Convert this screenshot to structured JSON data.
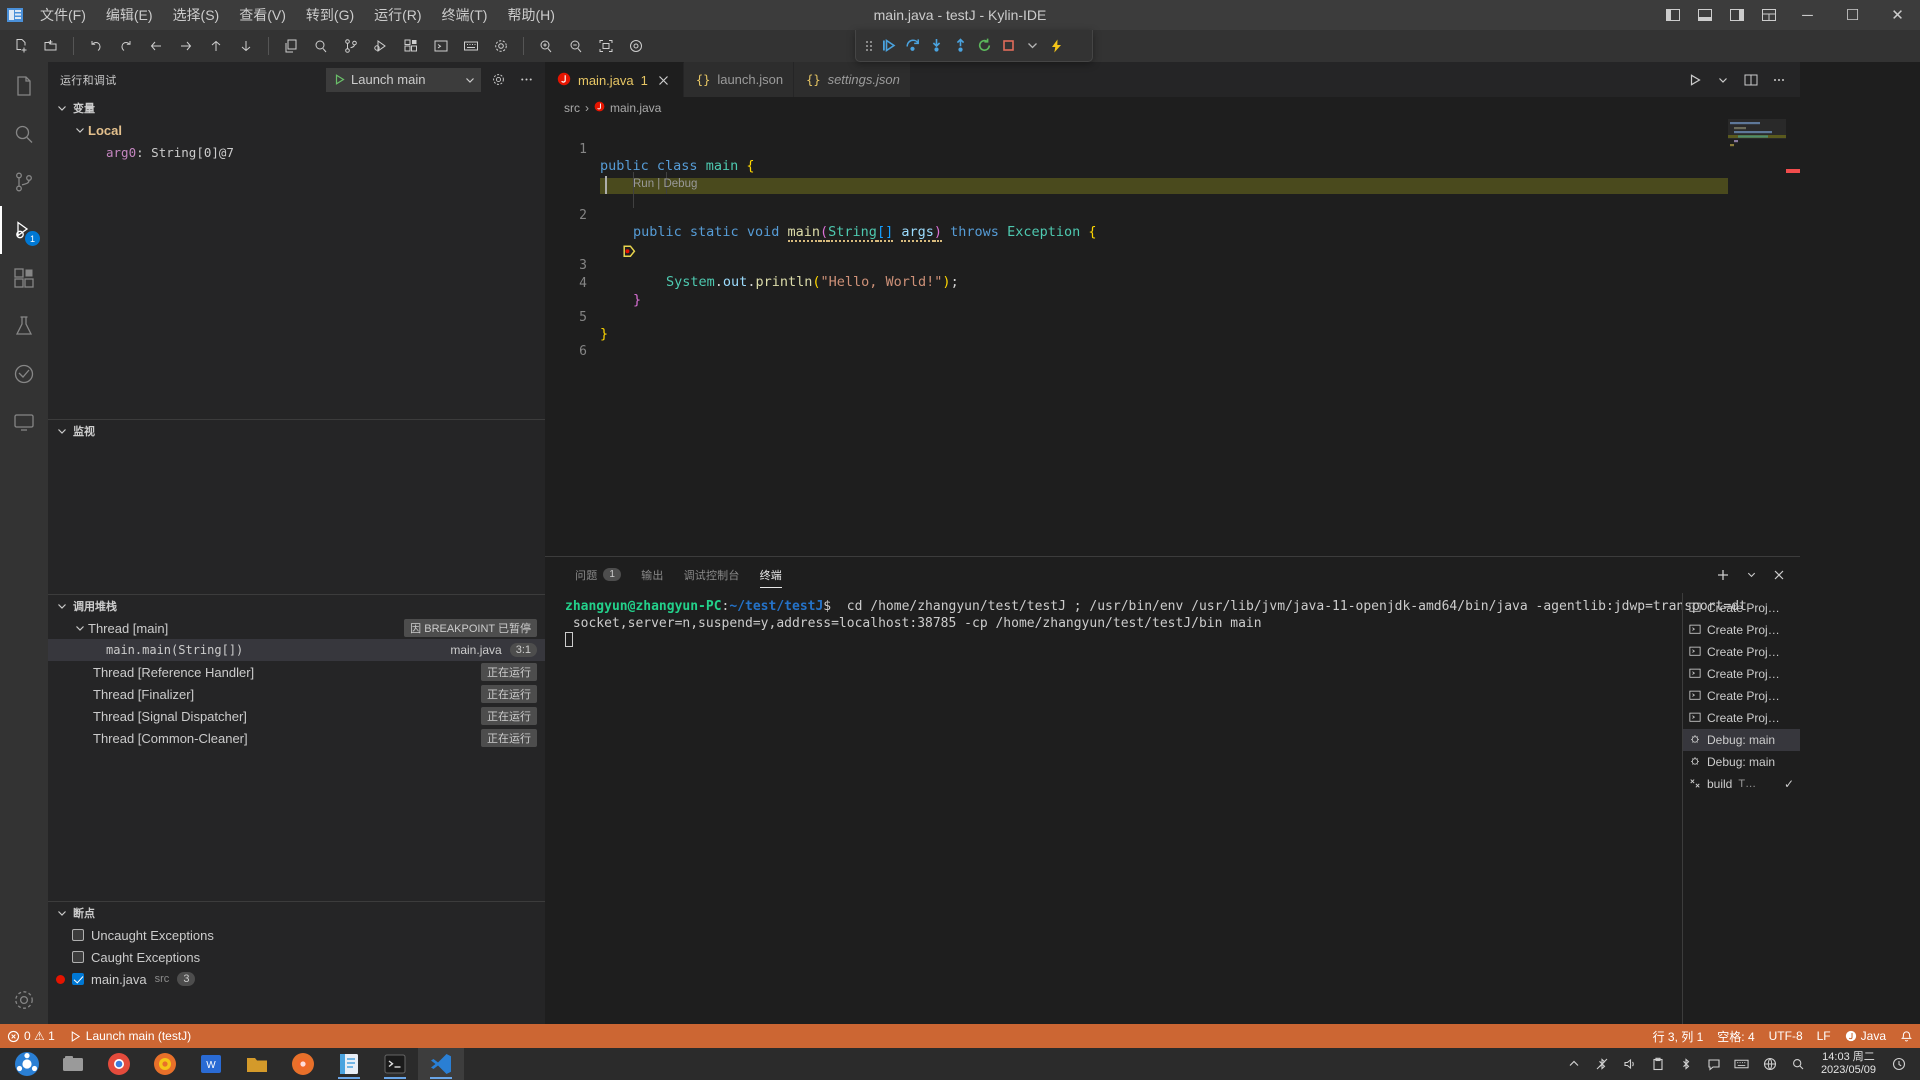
{
  "window": {
    "title": "main.java - testJ - Kylin-IDE",
    "menus": [
      {
        "label": "文件(F)"
      },
      {
        "label": "编辑(E)"
      },
      {
        "label": "选择(S)"
      },
      {
        "label": "查看(V)"
      },
      {
        "label": "转到(G)"
      },
      {
        "label": "运行(R)"
      },
      {
        "label": "终端(T)"
      },
      {
        "label": "帮助(H)"
      }
    ],
    "layout_icons": [
      "panel-left-icon",
      "panel-bottom-icon",
      "panel-right-icon",
      "customize-layout-icon"
    ],
    "controls": {
      "minimize": "─",
      "maximize": "☐",
      "close": "✕"
    }
  },
  "toolbar": {
    "groups": [
      [
        "new-file-icon",
        "new-folder-icon"
      ],
      [
        "undo-icon",
        "redo-icon",
        "back-icon",
        "forward-icon",
        "up-icon",
        "down-icon"
      ],
      [
        "copy-icon",
        "search-icon",
        "source-control-icon",
        "run-debug-icon",
        "extensions-icon",
        "terminal-icon",
        "keyboard-icon",
        "settings-gear-icon"
      ],
      [
        "zoom-in-icon",
        "zoom-out-icon",
        "fit-screen-icon",
        "target-icon"
      ]
    ]
  },
  "debug_toolbar": {
    "buttons": [
      {
        "name": "drag-handle",
        "icon": "grip-icon"
      },
      {
        "name": "continue",
        "icon": "continue-icon"
      },
      {
        "name": "step-over",
        "icon": "step-over-icon"
      },
      {
        "name": "step-into",
        "icon": "step-into-icon"
      },
      {
        "name": "step-out",
        "icon": "step-out-icon"
      },
      {
        "name": "restart",
        "icon": "restart-icon"
      },
      {
        "name": "stop",
        "icon": "stop-icon"
      },
      {
        "name": "more",
        "icon": "chevron-down-icon"
      },
      {
        "name": "hot-reload",
        "icon": "lightning-icon"
      }
    ]
  },
  "activitybar": {
    "items": [
      {
        "name": "explorer",
        "icon": "files-icon",
        "badge": ""
      },
      {
        "name": "search",
        "icon": "search-icon",
        "badge": ""
      },
      {
        "name": "source-control",
        "icon": "branch-icon",
        "badge": ""
      },
      {
        "name": "run-and-debug",
        "icon": "debug-icon",
        "badge": "1",
        "active": true
      },
      {
        "name": "extensions",
        "icon": "extensions-icon",
        "badge": ""
      },
      {
        "name": "testing",
        "icon": "beaker-icon",
        "badge": ""
      },
      {
        "name": "remote",
        "icon": "remote-icon",
        "badge": ""
      },
      {
        "name": "display",
        "icon": "screen-icon",
        "badge": ""
      }
    ],
    "bottom": [
      {
        "name": "manage",
        "icon": "gear-icon"
      }
    ]
  },
  "sidebar": {
    "title": "运行和调试",
    "launch_config": "Launch main",
    "header_actions": [
      "gear-icon",
      "more-icon"
    ],
    "sections": [
      {
        "id": "variables",
        "label": "变量",
        "expanded": true,
        "rows": [
          {
            "indent": 1,
            "label": "Local",
            "kind": "scope",
            "expanded": true
          },
          {
            "indent": 2,
            "name": "arg0",
            "value": "String[0]@7",
            "kind": "var"
          }
        ]
      },
      {
        "id": "watch",
        "label": "监视",
        "expanded": true,
        "rows": []
      },
      {
        "id": "callstack",
        "label": "调用堆栈",
        "expanded": true,
        "rows": [
          {
            "indent": 1,
            "label": "Thread [main]",
            "badge": "因 BREAKPOINT 已暂停",
            "kind": "thread",
            "expanded": true
          },
          {
            "indent": 2,
            "label": "main.main(String[])",
            "file": "main.java",
            "pos": "3:1",
            "kind": "frame",
            "selected": true
          },
          {
            "indent": 1,
            "label": "Thread [Reference Handler]",
            "badge": "正在运行",
            "kind": "thread"
          },
          {
            "indent": 1,
            "label": "Thread [Finalizer]",
            "badge": "正在运行",
            "kind": "thread"
          },
          {
            "indent": 1,
            "label": "Thread [Signal Dispatcher]",
            "badge": "正在运行",
            "kind": "thread"
          },
          {
            "indent": 1,
            "label": "Thread [Common-Cleaner]",
            "badge": "正在运行",
            "kind": "thread"
          }
        ]
      },
      {
        "id": "breakpoints",
        "label": "断点",
        "expanded": true,
        "rows": [
          {
            "label": "Uncaught Exceptions",
            "checked": false
          },
          {
            "label": "Caught Exceptions",
            "checked": false
          },
          {
            "label": "main.java",
            "sub": "src",
            "checked": true,
            "count": "3",
            "dot": true
          }
        ]
      }
    ]
  },
  "editor": {
    "tabs": [
      {
        "label": "main.java",
        "badge": "1",
        "icon": "java-icon",
        "active": true,
        "closable": true,
        "italic": false
      },
      {
        "label": "launch.json",
        "icon": "json-icon",
        "active": false,
        "closable": false,
        "italic": false
      },
      {
        "label": "settings.json",
        "icon": "json-icon",
        "active": false,
        "closable": false,
        "italic": true
      }
    ],
    "actions": [
      "run-icon",
      "chevron-down-icon",
      "split-editor-icon",
      "more-icon"
    ],
    "breadcrumb": [
      "src",
      "main.java"
    ],
    "codelens": "Run | Debug",
    "lines": [
      {
        "n": "1",
        "text": "public class main {"
      },
      {
        "n": "2",
        "text": "    public static void main(String[] args) throws Exception {"
      },
      {
        "n": "3",
        "text": "        System.out.println(\"Hello, World!\");",
        "breakpoint": true,
        "current": true
      },
      {
        "n": "4",
        "text": "    }"
      },
      {
        "n": "5",
        "text": "}"
      },
      {
        "n": "6",
        "text": ""
      }
    ]
  },
  "panel": {
    "tabs": [
      {
        "label": "问题",
        "badge": "1",
        "active": false
      },
      {
        "label": "输出",
        "badge": "",
        "active": false
      },
      {
        "label": "调试控制台",
        "badge": "",
        "active": false
      },
      {
        "label": "终端",
        "badge": "",
        "active": true
      }
    ],
    "actions": [
      "add-terminal-icon",
      "chevron-down-icon",
      "close-panel-icon"
    ],
    "terminal": {
      "prompt_user": "zhangyun@zhangyun-PC",
      "prompt_path": "~/test/testJ",
      "prompt_sym": "$",
      "command": "cd /home/zhangyun/test/testJ ; /usr/bin/env /usr/lib/jvm/java-11-openjdk-amd64/bin/java -agentlib:jdwp=transport=dt_socket,server=n,suspend=y,address=localhost:38785 -cp /home/zhangyun/test/testJ/bin main"
    },
    "terminal_list": [
      {
        "label": "Create Proj…",
        "icon": "terminal-icon"
      },
      {
        "label": "Create Proj…",
        "icon": "terminal-icon"
      },
      {
        "label": "Create Proj…",
        "icon": "terminal-icon"
      },
      {
        "label": "Create Proj…",
        "icon": "terminal-icon"
      },
      {
        "label": "Create Proj…",
        "icon": "terminal-icon"
      },
      {
        "label": "Create Proj…",
        "icon": "terminal-icon"
      },
      {
        "label": "Debug: main",
        "icon": "debug-console-icon",
        "selected": true
      },
      {
        "label": "Debug: main",
        "icon": "debug-console-icon"
      },
      {
        "label": "build",
        "icon": "tools-icon",
        "suffix": "T…",
        "check": "✓"
      }
    ]
  },
  "statusbar": {
    "left": [
      {
        "name": "problems",
        "icon": "error-warning-icon",
        "text": "0 ⚠ 1"
      },
      {
        "name": "launch-target",
        "icon": "debug-alt-icon",
        "text": "Launch main (testJ)"
      }
    ],
    "right": [
      {
        "name": "cursor-position",
        "text": "行 3, 列 1"
      },
      {
        "name": "indentation",
        "text": "空格: 4"
      },
      {
        "name": "encoding",
        "text": "UTF-8"
      },
      {
        "name": "eol",
        "text": "LF"
      },
      {
        "name": "language-mode",
        "text": "Java"
      },
      {
        "name": "notifications",
        "text": "🔔"
      }
    ]
  },
  "taskbar": {
    "apps": [
      {
        "name": "start-menu",
        "icon": "ubuntu-kylin-icon",
        "color": "#2a7fd4"
      },
      {
        "name": "file-manager",
        "icon": "folder-icon",
        "color": "#8d8d8d"
      },
      {
        "name": "browser-chrome",
        "icon": "chrome-icon",
        "color": "#e44b3c"
      },
      {
        "name": "firefox",
        "icon": "firefox-icon",
        "color": "#e8702a"
      },
      {
        "name": "wps-writer",
        "icon": "wps-icon",
        "color": "#2a6bd4"
      },
      {
        "name": "file-explorer",
        "icon": "files2-icon",
        "color": "#d49a2a"
      },
      {
        "name": "firefox-dev",
        "icon": "firefox2-icon",
        "color": "#e8702a"
      },
      {
        "name": "text-editor",
        "icon": "editor-icon",
        "color": "#4aa3df",
        "running": true
      },
      {
        "name": "terminal-app",
        "icon": "terminal2-icon",
        "color": "#2b2b2b",
        "running": true
      },
      {
        "name": "vscode",
        "icon": "vscode-icon",
        "color": "#2a7fd4",
        "running": true,
        "active": true
      }
    ],
    "tray": [
      "chevron-up-icon",
      "bluetooth-off-icon",
      "volume-icon",
      "clipboard-icon",
      "bluetooth-icon",
      "chat-icon",
      "keyboard-icon",
      "globe-icon",
      "search-icon"
    ],
    "clock_time": "14:03 周二",
    "clock_date": "2023/05/09",
    "show_desktop": "notification-icon"
  }
}
